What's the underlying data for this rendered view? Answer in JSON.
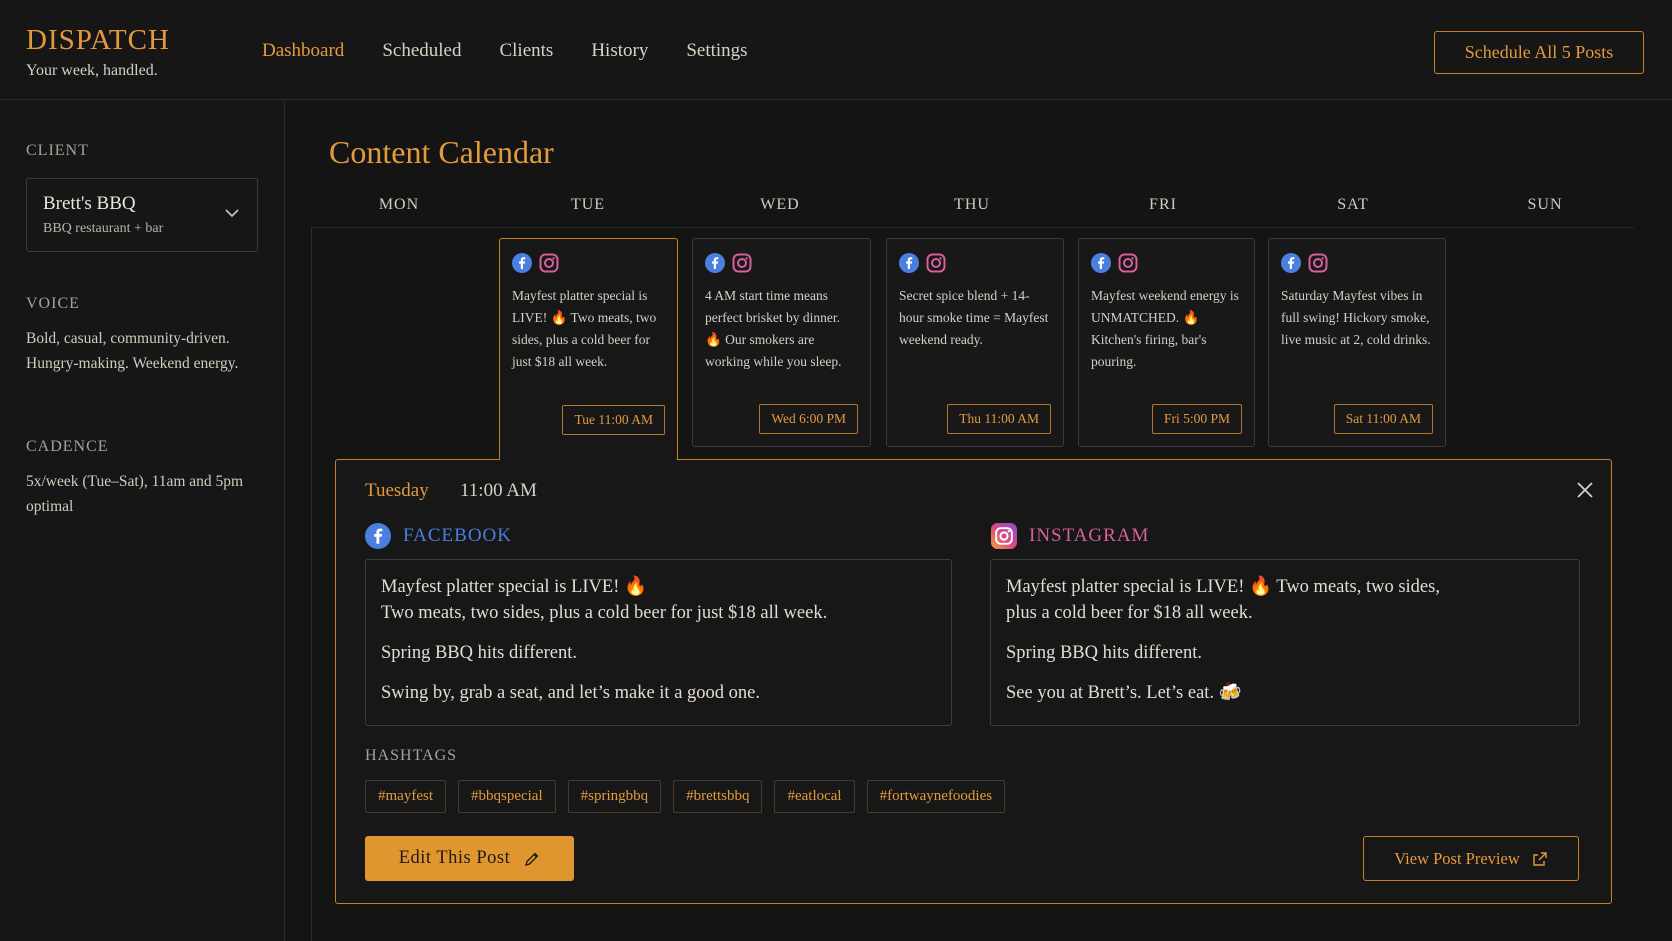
{
  "app": {
    "brand": "DISPATCH",
    "tagline": "Your week, handled."
  },
  "nav": {
    "items": [
      {
        "label": "Dashboard",
        "active": true
      },
      {
        "label": "Scheduled"
      },
      {
        "label": "Clients"
      },
      {
        "label": "History"
      },
      {
        "label": "Settings"
      }
    ],
    "schedule_all_label": "Schedule All 5 Posts"
  },
  "sidebar": {
    "client_label": "CLIENT",
    "client_name": "Brett's BBQ",
    "client_type": "BBQ restaurant + bar",
    "voice_label": "VOICE",
    "voice_text": "Bold, casual, community-driven. Hungry-making. Weekend energy.",
    "cadence_label": "CADENCE",
    "cadence_text": "5x/week (Tue–Sat), 11am and 5pm optimal"
  },
  "calendar": {
    "title": "Content Calendar",
    "days": [
      "MON",
      "TUE",
      "WED",
      "THU",
      "FRI",
      "SAT",
      "SUN"
    ],
    "posts": [
      {
        "text": "Mayfest platter special is LIVE! 🔥 Two meats, two sides, plus a cold beer for just $18 all week.",
        "time": "Tue 11:00 AM",
        "selected": true
      },
      {
        "text": "4 AM start time means perfect brisket by dinner. 🔥 Our smokers are working while you sleep.",
        "time": "Wed 6:00 PM"
      },
      {
        "text": "Secret spice blend + 14-hour smoke time = Mayfest weekend ready.",
        "time": "Thu 11:00 AM"
      },
      {
        "text": "Mayfest weekend energy is UNMATCHED. 🔥 Kitchen's firing, bar's pouring.",
        "time": "Fri 5:00 PM"
      },
      {
        "text": "Saturday Mayfest vibes in full swing! Hickory smoke, live music at 2, cold drinks.",
        "time": "Sat 11:00 AM"
      }
    ]
  },
  "detail": {
    "day": "Tuesday",
    "time": "11:00 AM",
    "facebook": {
      "label": "FACEBOOK",
      "color": "#4a7fe0",
      "line1": "Mayfest platter special is LIVE! 🔥",
      "line2": "Two meats, two sides, plus a cold beer for just $18 all week.",
      "line3": "Spring BBQ hits different.",
      "line4": "Swing by, grab a seat, and let’s make it a good one."
    },
    "instagram": {
      "label": "INSTAGRAM",
      "color": "#d9609a",
      "line1": "Mayfest platter special is LIVE! 🔥 Two meats, two sides,",
      "line2": "plus a cold beer for $18 all week.",
      "line3": "Spring BBQ hits different.",
      "line4": "See you at Brett’s. Let’s eat. 🍻"
    },
    "hashtags_label": "HASHTAGS",
    "hashtags": [
      "#mayfest",
      "#bbqspecial",
      "#springbbq",
      "#brettsbbq",
      "#eatlocal",
      "#fortwaynefoodies"
    ],
    "edit_label": "Edit This Post",
    "preview_label": "View Post Preview"
  },
  "colors": {
    "accent": "#e39a3c",
    "background": "#141414",
    "facebook": "#4a7fe0",
    "instagram": "#d9609a"
  }
}
